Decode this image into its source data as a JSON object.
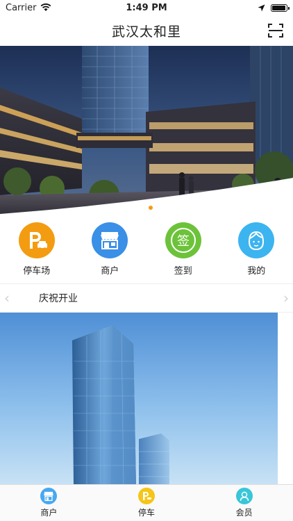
{
  "status_bar": {
    "carrier": "Carrier",
    "time": "1:49 PM",
    "battery_level": 0.95
  },
  "header": {
    "title": "武汉太和里",
    "scan_icon": "scan-icon"
  },
  "banner": {
    "slide_count": 2,
    "active_slide": 2,
    "indicator_active_color": "#f39c12"
  },
  "quick_menu": [
    {
      "label": "停车场",
      "icon": "parking-icon",
      "color": "#f39c12"
    },
    {
      "label": "商户",
      "icon": "store-icon",
      "color": "#3a8fe6"
    },
    {
      "label": "签到",
      "icon": "checkin-icon",
      "color": "#6cc33a"
    },
    {
      "label": "我的",
      "icon": "profile-icon",
      "color": "#3cb4f0"
    }
  ],
  "notice": {
    "text": "庆祝开业"
  },
  "tab_bar": [
    {
      "label": "商户",
      "icon": "store-icon",
      "color": "#48a8f0"
    },
    {
      "label": "停车",
      "icon": "parking-icon",
      "color": "#f5c518"
    },
    {
      "label": "会员",
      "icon": "member-icon",
      "color": "#39c6d8"
    }
  ]
}
